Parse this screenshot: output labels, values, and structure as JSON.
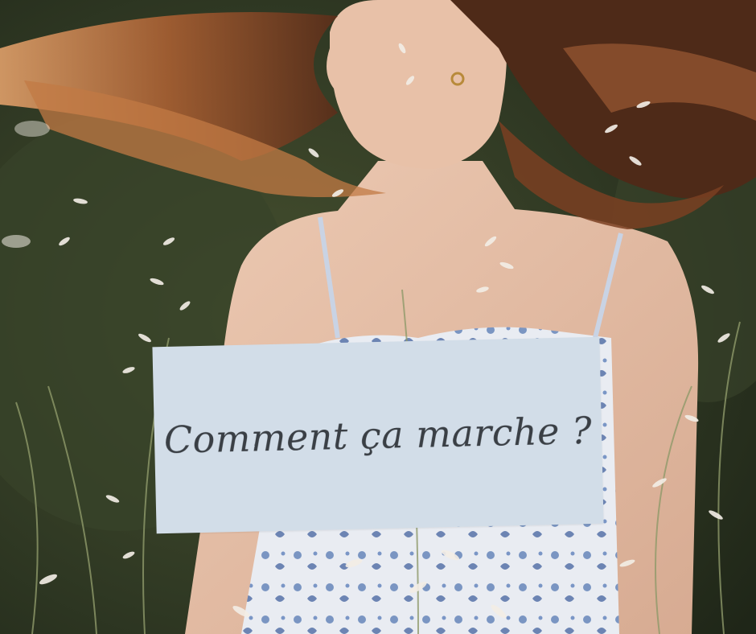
{
  "card": {
    "title": "Comment ça marche ?"
  },
  "colors": {
    "card_background": "#d2dde8",
    "card_text": "#3a3f45",
    "foliage_dark": "#2c3320",
    "hair": "#b0683a",
    "skin": "#e2bca4",
    "dress_blue": "#5e7fb6",
    "grass": "#efe9e0"
  }
}
